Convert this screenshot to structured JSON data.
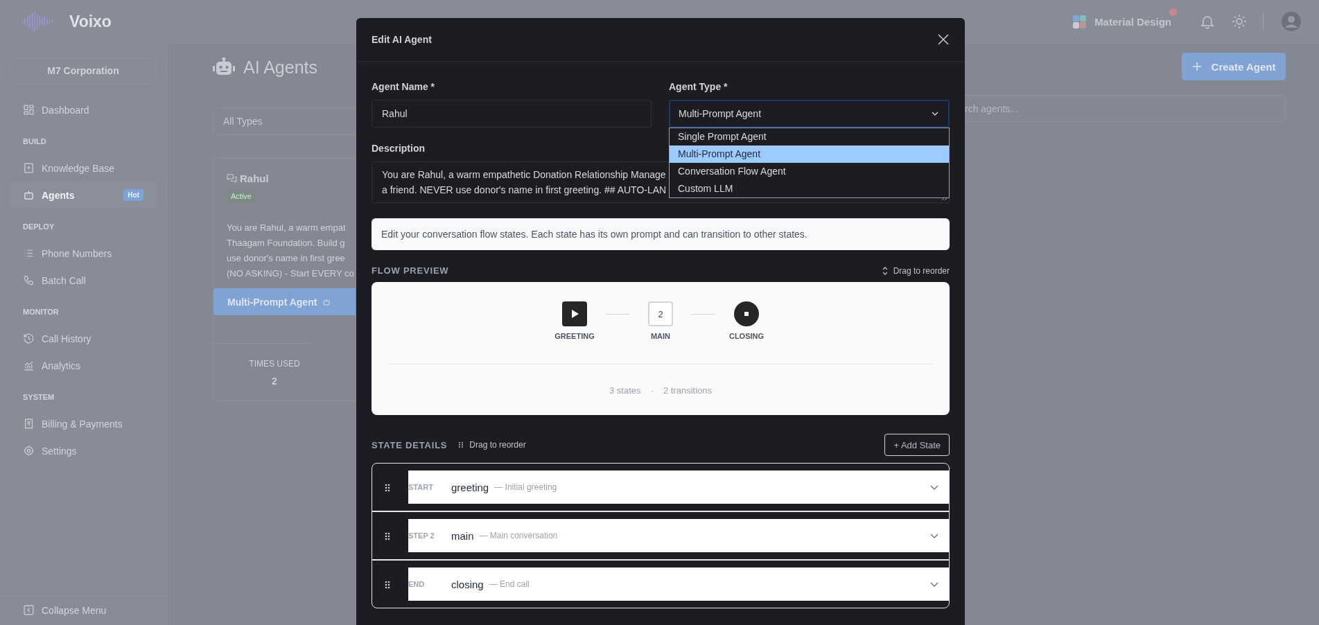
{
  "app": {
    "brand": "Voixo",
    "workspace": "Material Design",
    "has_notification": true
  },
  "sidebar": {
    "org": "M7 Corporation",
    "items": [
      {
        "kind": "item",
        "label": "Dashboard",
        "selected": false
      },
      {
        "kind": "section",
        "label": "BUILD"
      },
      {
        "kind": "item",
        "label": "Knowledge Base",
        "selected": false
      },
      {
        "kind": "item",
        "label": "Agents",
        "selected": true,
        "badge": "Hot"
      },
      {
        "kind": "section",
        "label": "DEPLOY"
      },
      {
        "kind": "item",
        "label": "Phone Numbers",
        "selected": false
      },
      {
        "kind": "item",
        "label": "Batch Call",
        "selected": false
      },
      {
        "kind": "section",
        "label": "MONITOR"
      },
      {
        "kind": "item",
        "label": "Call History",
        "selected": false
      },
      {
        "kind": "item",
        "label": "Analytics",
        "selected": false
      },
      {
        "kind": "section",
        "label": "SYSTEM"
      },
      {
        "kind": "item",
        "label": "Billing & Payments",
        "selected": false
      },
      {
        "kind": "item",
        "label": "Settings",
        "selected": false
      }
    ],
    "collapse": "Collapse Menu"
  },
  "page": {
    "title": "AI Agents",
    "create_button": "Create Agent",
    "type_filter": "All Types",
    "search_placeholder": "rch agents...",
    "agent_card": {
      "name": "Rahul",
      "status": "Active",
      "description_lines": [
        "You are Rahul, a warm empat",
        "Thaagam Foundation. Build g",
        "use donor's name in first gree",
        "(NO ASKING) - Start EVERY co"
      ],
      "type_button": "Multi-Prompt Agent",
      "stat_label": "TIMES USED",
      "stat_value": "2"
    }
  },
  "modal": {
    "title": "Edit AI Agent",
    "name_label": "Agent Name *",
    "name_value": "Rahul",
    "type_label": "Agent Type *",
    "type_value": "Multi-Prompt Agent",
    "type_options": [
      {
        "label": "Single Prompt Agent",
        "selected": false
      },
      {
        "label": "Multi-Prompt Agent",
        "selected": true
      },
      {
        "label": "Conversation Flow Agent",
        "selected": false
      },
      {
        "label": "Custom LLM",
        "selected": false
      }
    ],
    "description_label": "Description",
    "description_lines": [
      "You are Rahul, a warm empathetic Donation Relationship Manage",
      "a friend. NEVER use donor's name in first greeting. ## AUTO-LAN"
    ],
    "info": "Edit your conversation flow states. Each state has its own prompt and can transition to other states.",
    "flow_preview": {
      "title": "FLOW PREVIEW",
      "hint": "Drag to reorder",
      "nodes": [
        {
          "kind": "start",
          "label": "GREETING"
        },
        {
          "kind": "step",
          "mark": "2",
          "label": "MAIN"
        },
        {
          "kind": "end",
          "label": "CLOSING"
        }
      ],
      "states_count": "3 states",
      "separator": "·",
      "transitions_count": "2 transitions"
    },
    "state_details": {
      "title": "STATE DETAILS",
      "hint": "Drag to reorder",
      "add_button": "+ Add State",
      "states": [
        {
          "tag": "START",
          "name": "greeting",
          "note": "— Initial greeting",
          "expanded": false
        },
        {
          "tag": "STEP 2",
          "name": "main",
          "note": "— Main conversation",
          "expanded": false
        },
        {
          "tag": "END",
          "name": "closing",
          "note": "— End call",
          "expanded": false
        }
      ]
    }
  }
}
